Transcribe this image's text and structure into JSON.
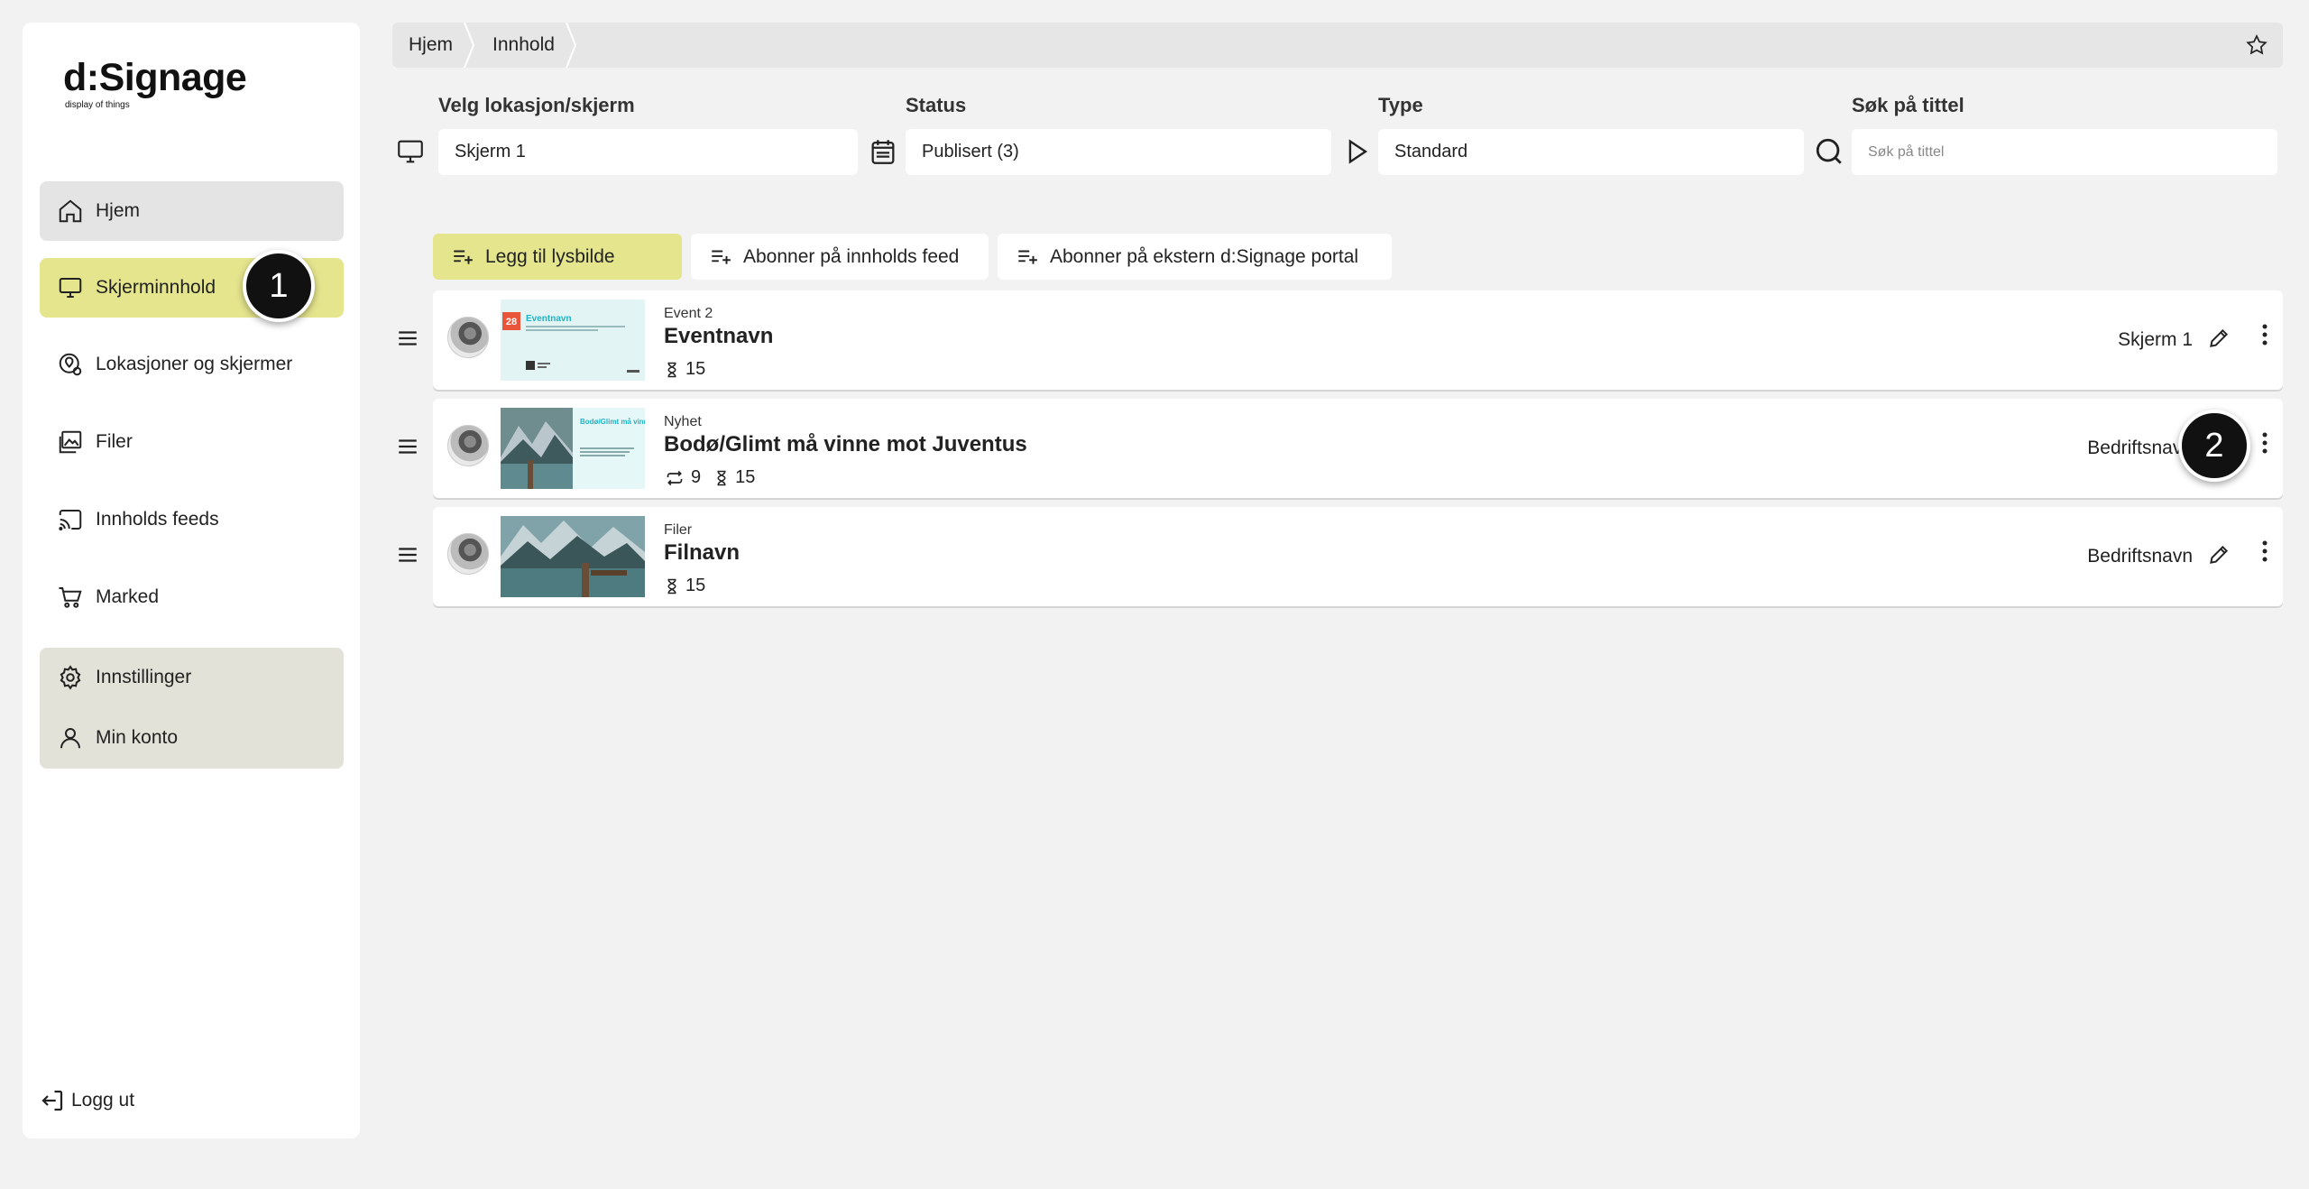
{
  "logo": {
    "name": "d:Signage",
    "tagline": "display of things"
  },
  "sidebar": {
    "items": [
      {
        "label": "Hjem",
        "icon": "home-icon"
      },
      {
        "label": "Skjerminnhold",
        "icon": "monitor-icon"
      },
      {
        "label": "Lokasjoner og skjermer",
        "icon": "location-icon"
      },
      {
        "label": "Filer",
        "icon": "images-icon"
      },
      {
        "label": "Innholds feeds",
        "icon": "cast-icon"
      },
      {
        "label": "Marked",
        "icon": "cart-icon"
      }
    ],
    "group": [
      {
        "label": "Innstillinger",
        "icon": "gear-icon"
      },
      {
        "label": "Min konto",
        "icon": "user-icon"
      }
    ],
    "logout": "Logg ut",
    "active_color": "#e5e58e"
  },
  "badges": {
    "one": "1",
    "two": "2"
  },
  "breadcrumb": [
    "Hjem",
    "Innhold"
  ],
  "filters": {
    "location": {
      "label": "Velg lokasjon/skjerm",
      "value": "Skjerm 1"
    },
    "status": {
      "label": "Status",
      "value": "Publisert (3)"
    },
    "type": {
      "label": "Type",
      "value": "Standard"
    },
    "search": {
      "label": "Søk på tittel",
      "placeholder": "Søk på tittel"
    }
  },
  "actions": {
    "add_slide": "Legg til lysbilde",
    "subscribe_feed": "Abonner på innholds feed",
    "subscribe_portal": "Abonner på ekstern d:Signage portal"
  },
  "rows": [
    {
      "type": "Event 2",
      "title": "Eventnavn",
      "duration": "15",
      "target": "Skjerm 1",
      "thumb": {
        "day": "28",
        "heading": "Eventnavn"
      }
    },
    {
      "type": "Nyhet",
      "title": "Bodø/Glimt må vinne mot Juventus",
      "repeat": "9",
      "duration": "15",
      "target": "Bedriftsnavn",
      "thumb": {
        "heading": "Bodø/Glimt må vinne mot Juventus"
      }
    },
    {
      "type": "Filer",
      "title": "Filnavn",
      "duration": "15",
      "target": "Bedriftsnavn"
    }
  ]
}
